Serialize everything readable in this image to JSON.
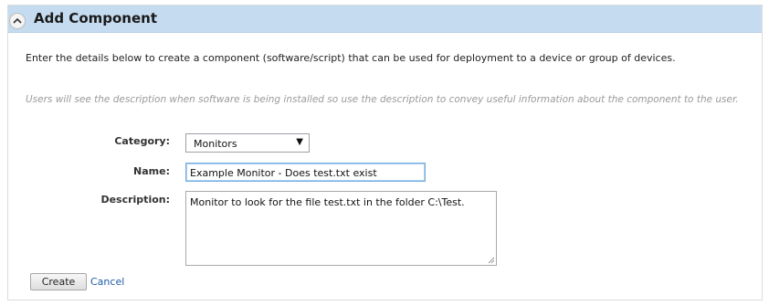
{
  "header": {
    "title": "Add Component",
    "collapse_icon": "chevron-up-icon"
  },
  "intro_text": "Enter the details below to create a component (software/script) that can be used for deployment to a device or group of devices.",
  "hint_text": "Users will see the description when software is being installed so use the description to convey useful information about the component to the user.",
  "form": {
    "category": {
      "label": "Category:",
      "value": "Monitors"
    },
    "name": {
      "label": "Name:",
      "value": "Example Monitor - Does test.txt exist"
    },
    "description": {
      "label": "Description:",
      "value": "Monitor to look for the file test.txt in the folder C:\\Test."
    }
  },
  "actions": {
    "create_label": "Create",
    "cancel_label": "Cancel"
  },
  "colors": {
    "header_bg": "#c5dcf0",
    "link": "#1f5aa6",
    "hint": "#9a9a9a"
  }
}
